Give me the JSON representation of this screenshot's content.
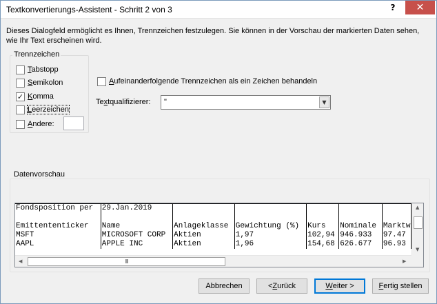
{
  "window": {
    "title": "Textkonvertierungs-Assistent - Schritt 2 von 3",
    "help_glyph": "?",
    "close_glyph": "✕"
  },
  "description": "Dieses Dialogfeld ermöglicht es Ihnen, Trennzeichen festzulegen. Sie können in der Vorschau der markierten Daten sehen, wie Ihr Text erscheinen wird.",
  "delimiters": {
    "title": "Trennzeichen",
    "options": [
      {
        "label": "Tabstopp",
        "checked": false
      },
      {
        "label": "Semikolon",
        "checked": false
      },
      {
        "label": "Komma",
        "checked": true
      },
      {
        "label": "Leerzeichen",
        "checked": false
      },
      {
        "label": "Andere:",
        "checked": false
      }
    ],
    "other_value": ""
  },
  "consecutive": {
    "label": "Aufeinanderfolgende Trennzeichen als ein Zeichen behandeln",
    "checked": false
  },
  "qualifier": {
    "label": "Textqualifizierer:",
    "value": "\""
  },
  "preview": {
    "title": "Datenvorschau",
    "rows": [
      [
        "Fondsposition per",
        "29.Jan.2019",
        "",
        "",
        "",
        "",
        "",
        ""
      ],
      [
        "",
        "",
        "",
        "",
        "",
        "",
        "",
        ""
      ],
      [
        "Emittententicker",
        "Name",
        "Anlageklasse",
        "Gewichtung (%)",
        "Kurs",
        "Nominale",
        "Marktw",
        ""
      ],
      [
        "MSFT",
        "MICROSOFT CORP",
        "Aktien",
        "1,97",
        "102,94",
        "946.933",
        "97.47",
        ""
      ],
      [
        "AAPL",
        "APPLE INC",
        "Aktien",
        "1,96",
        "154,68",
        "626.677",
        "96.93",
        ""
      ]
    ],
    "scroll_thumb_grip": "III"
  },
  "buttons": {
    "cancel": "Abbrechen",
    "back": "< Zurück",
    "next": "Weiter >",
    "finish": "Fertig stellen"
  },
  "colors": {
    "close_button": "#c7504b",
    "default_button_border": "#0078d7",
    "dialog_background": "#f0f0f0"
  }
}
